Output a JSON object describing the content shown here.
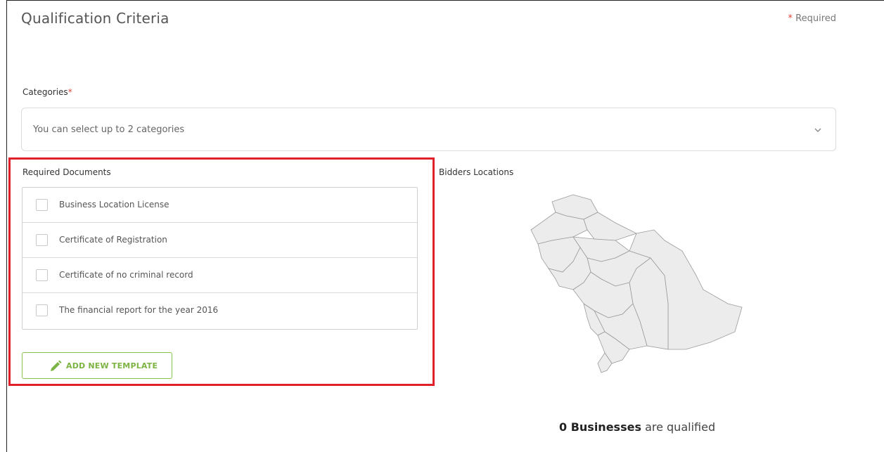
{
  "header": {
    "title": "Qualification Criteria",
    "required_star": "*",
    "required_text": "Required"
  },
  "categories": {
    "label": "Categories",
    "required_star": "*",
    "placeholder": "You can select up to 2 categories"
  },
  "documents": {
    "label": "Required Documents",
    "items": [
      {
        "label": "Business Location License",
        "checked": false
      },
      {
        "label": "Certificate of Registration",
        "checked": false
      },
      {
        "label": "Certificate of no criminal record",
        "checked": false
      },
      {
        "label": "The financial report for the year 2016",
        "checked": false
      }
    ],
    "add_button_label": "ADD NEW TEMPLATE",
    "add_button_icon": "pencil-icon"
  },
  "bidders": {
    "label": "Bidders Locations",
    "qualified_count": "0 Businesses",
    "qualified_suffix": "are qualified"
  },
  "colors": {
    "accent_green": "#7cb342",
    "highlight_red": "#e0202b",
    "required_red": "#e0453a",
    "map_fill": "#ececec"
  }
}
